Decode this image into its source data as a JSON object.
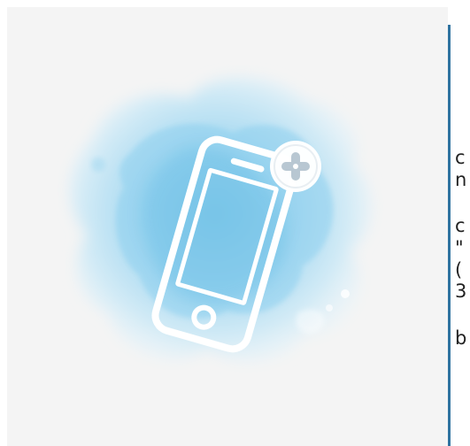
{
  "colors": {
    "panel_background": "#f4f4f4",
    "watercolor_light": "#c9e8f6",
    "watercolor_mid": "#9dd6f0",
    "watercolor_dark": "#6fc1e6",
    "device_outline": "#ffffff",
    "divider": "#2f73a0",
    "text": "#222222"
  },
  "illustration": {
    "main_icon": "smartphone-icon",
    "badge_icon": "plus-icon"
  },
  "side_text": {
    "line_1": "c",
    "line_2": "n",
    "line_3": "c",
    "line_4": "\"",
    "line_5": "(",
    "line_6": "3",
    "line_7": "b"
  }
}
